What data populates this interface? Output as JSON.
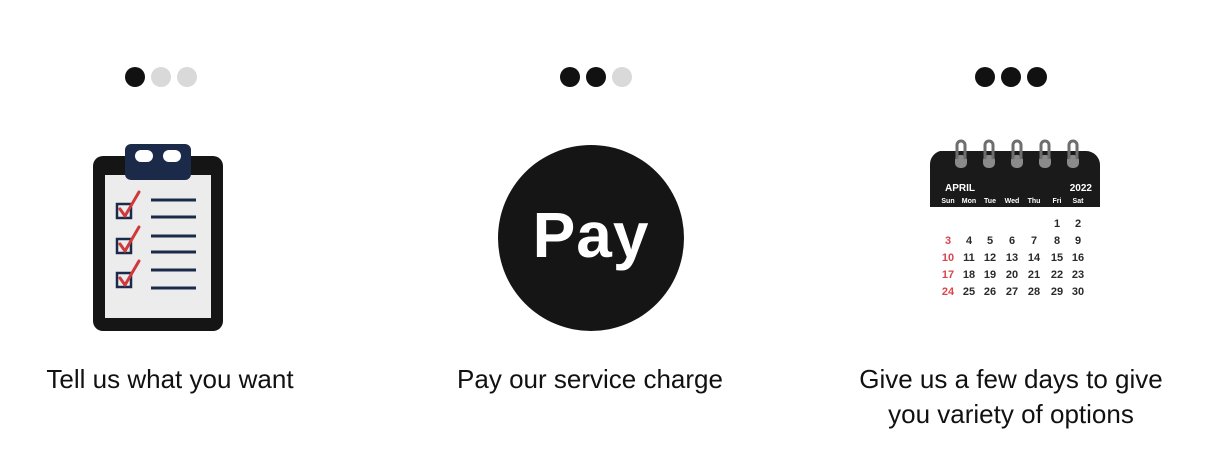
{
  "steps": [
    {
      "label": "Tell us what you want",
      "progress_filled": 1,
      "progress_total": 3,
      "icon": "clipboard-checklist-icon"
    },
    {
      "label": "Pay our service charge",
      "progress_filled": 2,
      "progress_total": 3,
      "icon": "pay-icon",
      "icon_text": "Pay"
    },
    {
      "label_line1": "Give us a few days to give",
      "label_line2": "you variety of options",
      "progress_filled": 3,
      "progress_total": 3,
      "icon": "calendar-icon"
    }
  ],
  "calendar": {
    "month": "APRIL",
    "year": "2022",
    "weekdays": [
      "Sun",
      "Mon",
      "Tue",
      "Wed",
      "Thu",
      "Fri",
      "Sat"
    ],
    "rows": [
      [
        "",
        "",
        "",
        "",
        "",
        "1",
        "2"
      ],
      [
        "3",
        "4",
        "5",
        "6",
        "7",
        "8",
        "9"
      ],
      [
        "10",
        "11",
        "12",
        "13",
        "14",
        "15",
        "16"
      ],
      [
        "17",
        "18",
        "19",
        "20",
        "21",
        "22",
        "23"
      ],
      [
        "24",
        "25",
        "26",
        "27",
        "28",
        "29",
        "30"
      ]
    ]
  },
  "colors": {
    "dot_active": "#111111",
    "dot_inactive": "#d9d9d9",
    "check_red": "#d0393b",
    "clip_navy": "#1c2a4a",
    "sunday_red": "#d9454c"
  }
}
